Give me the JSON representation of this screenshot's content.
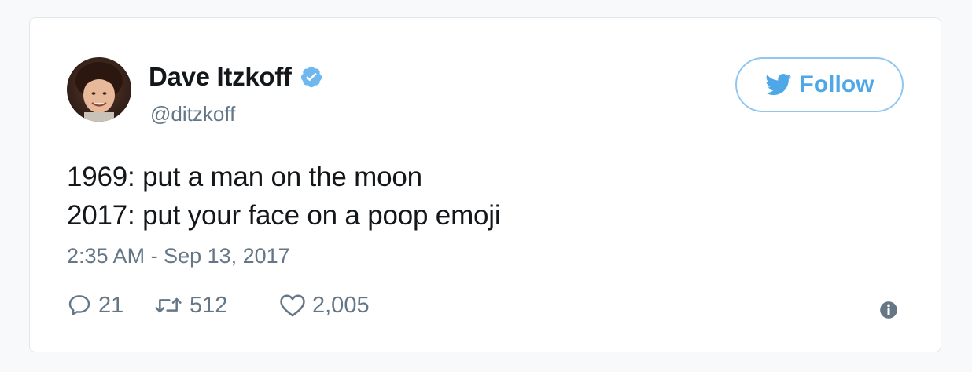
{
  "tweet": {
    "author_name": "Dave Itzkoff",
    "handle": "@ditzkoff",
    "verified": true,
    "follow_label": "Follow",
    "lines": [
      "1969: put a man on the moon",
      "2017: put your face on a poop emoji"
    ],
    "timestamp": "2:35 AM - Sep 13, 2017",
    "stats": {
      "replies": "21",
      "retweets": "512",
      "likes": "2,005"
    }
  },
  "icons": {
    "verified": "verified-badge-icon",
    "follow": "twitter-bird-icon",
    "reply": "reply-icon",
    "retweet": "retweet-icon",
    "like": "heart-icon",
    "info": "info-icon"
  },
  "colors": {
    "accent": "#1da1f2",
    "follow_text": "#4ea7e6",
    "follow_border": "#8fc7ef",
    "muted": "#657786",
    "text": "#14171a",
    "verified": "#6fb8ef"
  }
}
